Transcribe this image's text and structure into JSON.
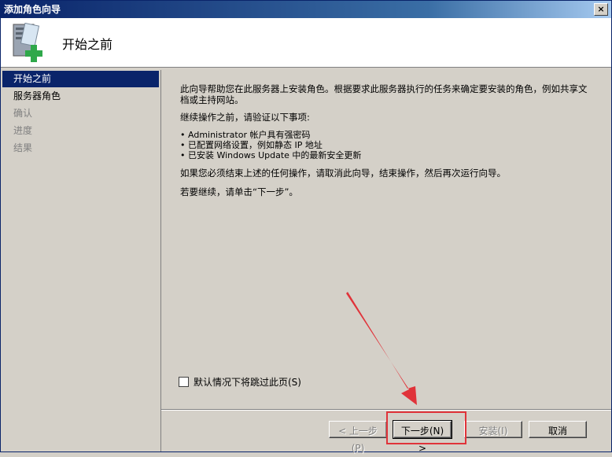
{
  "window": {
    "title": "添加角色向导",
    "close": "×"
  },
  "header": {
    "heading": "开始之前"
  },
  "sidebar": {
    "items": [
      {
        "label": "开始之前",
        "state": "active"
      },
      {
        "label": "服务器角色",
        "state": "normal"
      },
      {
        "label": "确认",
        "state": "disabled"
      },
      {
        "label": "进度",
        "state": "disabled"
      },
      {
        "label": "结果",
        "state": "disabled"
      }
    ]
  },
  "content": {
    "intro": "此向导帮助您在此服务器上安装角色。根据要求此服务器执行的任务来确定要安装的角色，例如共享文档或主持网站。",
    "verify": "继续操作之前，请验证以下事项:",
    "bullets": [
      "Administrator 帐户具有强密码",
      "已配置网络设置，例如静态 IP 地址",
      "已安装 Windows Update 中的最新安全更新"
    ],
    "cancel_note": "如果您必须结束上述的任何操作，请取消此向导，结束操作，然后再次运行向导。",
    "continue_note": "若要继续，请单击“下一步”。",
    "skip_checkbox": "默认情况下将跳过此页(S)"
  },
  "buttons": {
    "back": "< 上一步(P)",
    "next": "下一步(N) >",
    "install": "安装(I)",
    "cancel": "取消"
  },
  "colors": {
    "titlebar": "#0a246a",
    "highlight": "#e0333a"
  }
}
